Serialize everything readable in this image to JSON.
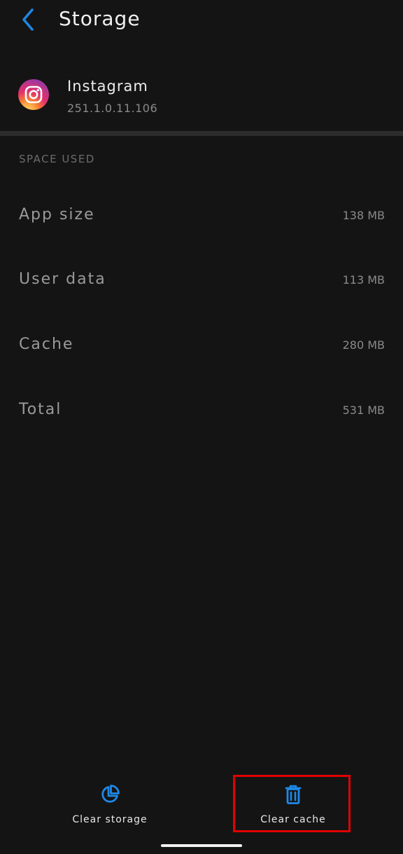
{
  "app_bar": {
    "title": "Storage",
    "back_icon": "chevron-left-icon"
  },
  "app_info": {
    "name": "Instagram",
    "version": "251.1.0.11.106",
    "icon": "instagram-logo"
  },
  "section": {
    "title": "SPACE USED"
  },
  "rows": [
    {
      "label": "App size",
      "value": "138 MB"
    },
    {
      "label": "User data",
      "value": "113 MB"
    },
    {
      "label": "Cache",
      "value": "280 MB"
    },
    {
      "label": "Total",
      "value": "531 MB"
    }
  ],
  "actions": {
    "clear_storage": {
      "label": "Clear storage",
      "icon": "pie-chart-icon"
    },
    "clear_cache": {
      "label": "Clear cache",
      "icon": "trash-icon"
    }
  },
  "colors": {
    "accent": "#1e88e5",
    "background": "#141414",
    "highlight": "#e10000"
  }
}
